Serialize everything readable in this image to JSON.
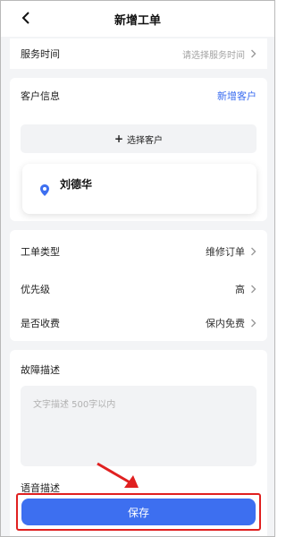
{
  "header": {
    "title": "新增工单"
  },
  "service_time": {
    "label": "服务时间",
    "placeholder": "请选择服务时间"
  },
  "customer": {
    "label": "客户信息",
    "add_link": "新增客户",
    "select_button": "选择客户",
    "selected_name": "刘德华"
  },
  "details": [
    {
      "label": "工单类型",
      "value": "维修订单"
    },
    {
      "label": "优先级",
      "value": "高"
    },
    {
      "label": "是否收费",
      "value": "保内免费"
    }
  ],
  "fault": {
    "label": "故障描述",
    "placeholder": "文字描述 500字以内"
  },
  "voice": {
    "label": "语音描述"
  },
  "save": {
    "label": "保存"
  },
  "colors": {
    "accent": "#3d6ff0",
    "link": "#3a6cf0",
    "highlight": "#e02020"
  }
}
